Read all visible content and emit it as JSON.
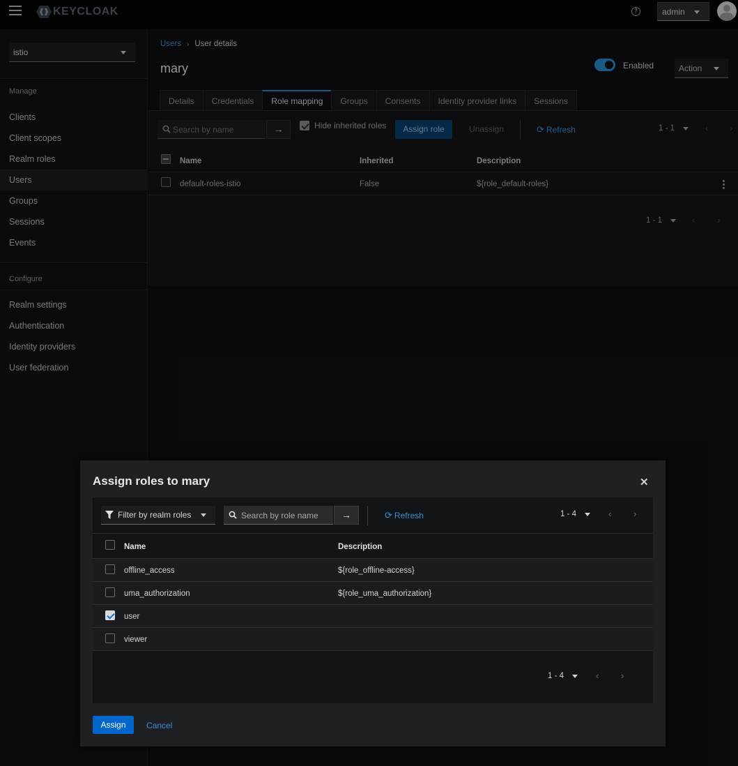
{
  "app": {
    "brand": "KEYCLOAK",
    "user_menu": "admin"
  },
  "sidebar": {
    "realm": "istio",
    "sections": [
      {
        "title": "Manage",
        "items": [
          "Clients",
          "Client scopes",
          "Realm roles",
          "Users",
          "Groups",
          "Sessions",
          "Events"
        ]
      },
      {
        "title": "Configure",
        "items": [
          "Realm settings",
          "Authentication",
          "Identity providers",
          "User federation"
        ]
      }
    ],
    "active_item": "Users"
  },
  "main": {
    "breadcrumb": {
      "link": "Users",
      "current": "User details"
    },
    "title": "mary",
    "enabled_label": "Enabled",
    "enabled": true,
    "action_label": "Action",
    "tabs": [
      "Details",
      "Credentials",
      "Role mapping",
      "Groups",
      "Consents",
      "Identity provider links",
      "Sessions"
    ],
    "active_tab": "Role mapping",
    "toolbar": {
      "search_placeholder": "Search by name",
      "hide_inherited_label": "Hide inherited roles",
      "hide_inherited_checked": true,
      "assign_role_label": "Assign role",
      "unassign_label": "Unassign",
      "refresh_label": "Refresh",
      "pagination": "1 - 1"
    },
    "table": {
      "headers": {
        "name": "Name",
        "inherited": "Inherited",
        "description": "Description"
      },
      "rows": [
        {
          "name": "default-roles-istio",
          "inherited": "False",
          "description": "${role_default-roles}"
        }
      ]
    },
    "bottom_pagination": "1 - 1"
  },
  "modal": {
    "title": "Assign roles to mary",
    "filter_label": "Filter by realm roles",
    "search_placeholder": "Search by role name",
    "refresh_label": "Refresh",
    "pagination": "1 - 4",
    "bottom_pagination": "1 - 4",
    "headers": {
      "name": "Name",
      "description": "Description"
    },
    "rows": [
      {
        "name": "offline_access",
        "description": "${role_offline-access}",
        "checked": false
      },
      {
        "name": "uma_authorization",
        "description": "${role_uma_authorization}",
        "checked": false
      },
      {
        "name": "user",
        "description": "",
        "checked": true
      },
      {
        "name": "viewer",
        "description": "",
        "checked": false
      }
    ],
    "assign_label": "Assign",
    "cancel_label": "Cancel"
  },
  "colors": {
    "accent": "#0066cc",
    "link": "#3a8ed8"
  }
}
